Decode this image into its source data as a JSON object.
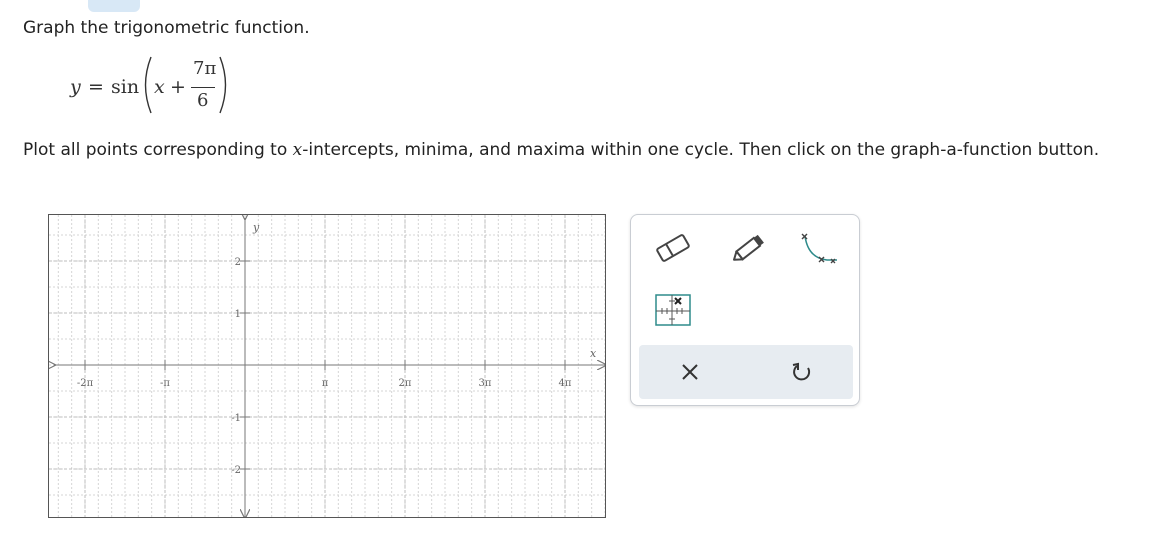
{
  "instruction": "Graph the trigonometric function.",
  "equation": {
    "lhs": "y",
    "equals": "=",
    "func": "sin",
    "variable": "x",
    "plus": "+",
    "numerator": "7π",
    "denominator": "6"
  },
  "plot_instruction": {
    "before": "Plot all points corresponding to ",
    "var": "x",
    "after": "-intercepts, minima, and maxima within one cycle. Then click on the graph-a-function button."
  },
  "graph": {
    "x_axis_label": "x",
    "y_axis_label": "y",
    "x_ticks": [
      {
        "value": -2,
        "label": "-2π"
      },
      {
        "value": -1,
        "label": "-π"
      },
      {
        "value": 1,
        "label": "π"
      },
      {
        "value": 2,
        "label": "2π"
      },
      {
        "value": 3,
        "label": "3π"
      },
      {
        "value": 4,
        "label": "4π"
      }
    ],
    "y_ticks": [
      {
        "value": 2,
        "label": "2"
      },
      {
        "value": 1,
        "label": "1"
      },
      {
        "value": -1,
        "label": "-1"
      },
      {
        "value": -2,
        "label": "-2"
      }
    ]
  },
  "tools": {
    "eraser": "eraser-icon",
    "pencil": "pencil-icon",
    "graph_function": "graph-function-icon",
    "point_tool": "point-tool-icon",
    "clear": "clear-icon",
    "undo": "undo-icon"
  },
  "colors": {
    "tool_accent": "#2e8b8b",
    "action_bar": "#e7ecf1",
    "grid_line": "#c4c4c4",
    "axis": "#777777"
  }
}
